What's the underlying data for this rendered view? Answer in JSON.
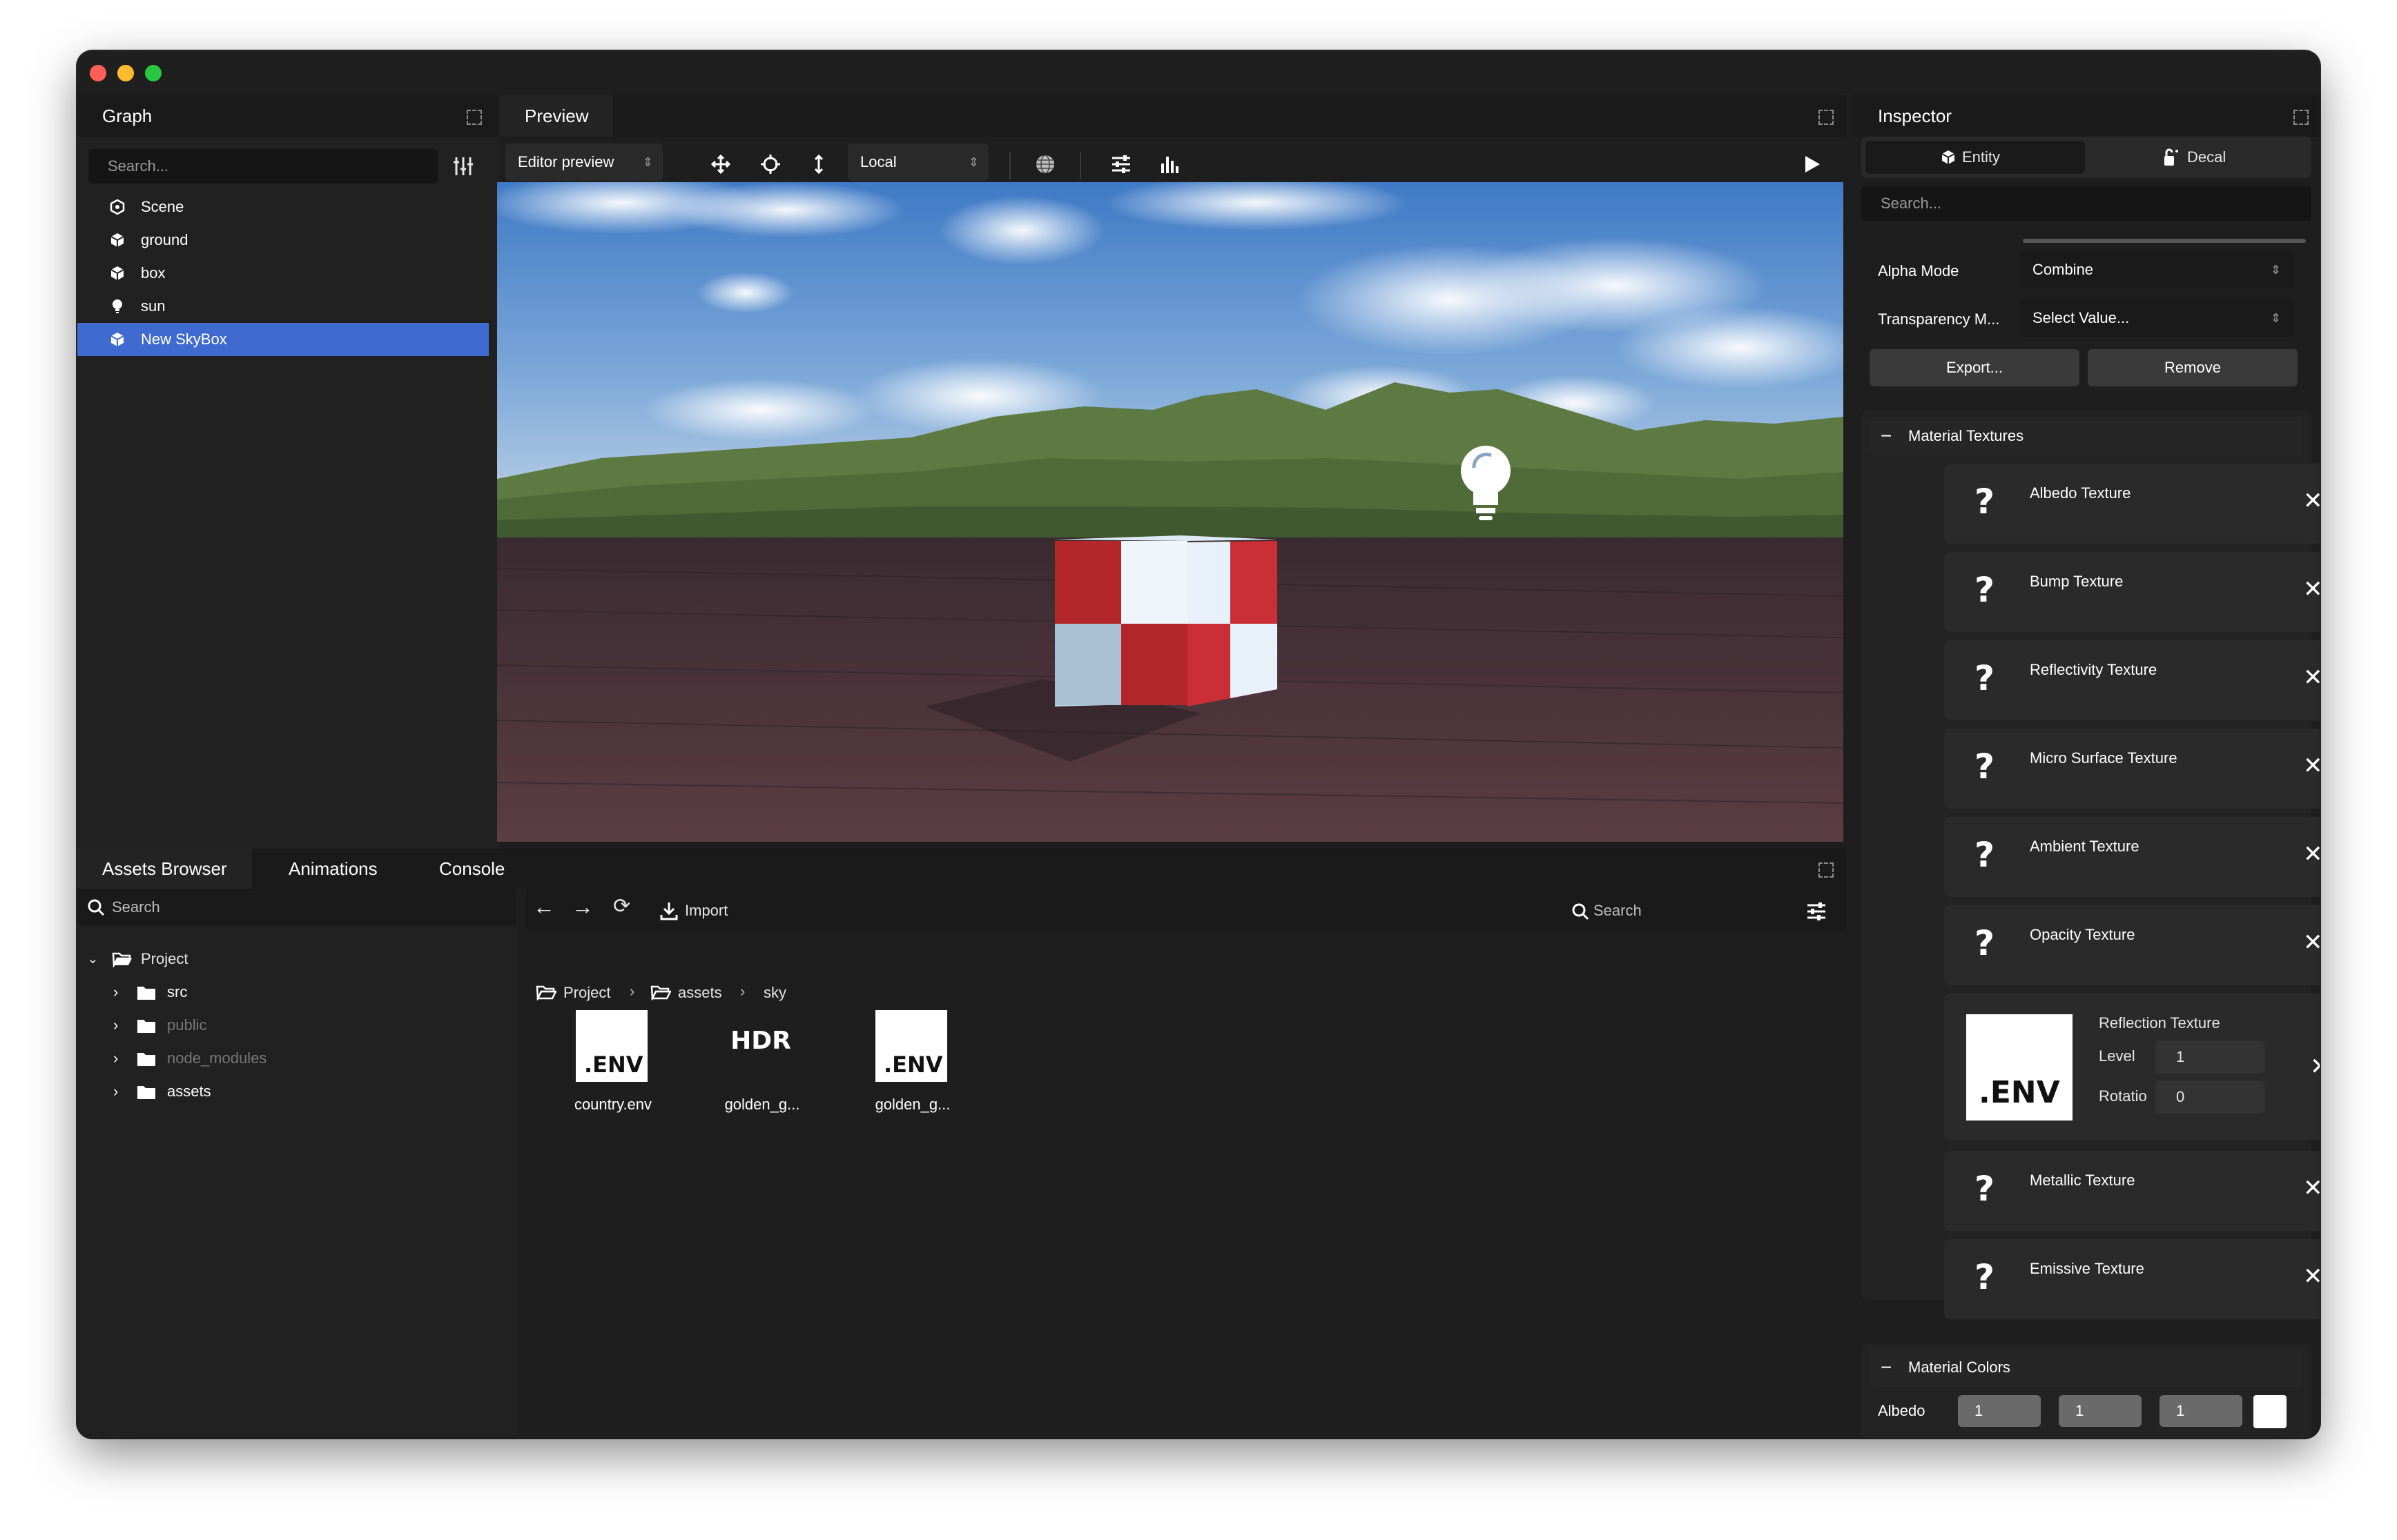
{
  "graph": {
    "tab": "Graph",
    "search_placeholder": "Search...",
    "items": [
      {
        "label": "Scene",
        "icon": "scene-icon"
      },
      {
        "label": "ground",
        "icon": "mesh-icon"
      },
      {
        "label": "box",
        "icon": "mesh-icon"
      },
      {
        "label": "sun",
        "icon": "light-bulb-icon"
      },
      {
        "label": "New SkyBox",
        "icon": "mesh-icon",
        "selected": true
      }
    ]
  },
  "preview": {
    "tab": "Preview",
    "camera_select": "Editor preview",
    "space_select": "Local",
    "tools": [
      "move-icon",
      "rotate-icon",
      "scale-icon",
      "globe-icon",
      "sliders-icon",
      "stats-icon"
    ],
    "play": "play-icon"
  },
  "inspector": {
    "tab": "Inspector",
    "modes": [
      "Entity",
      "Decal"
    ],
    "search_placeholder": "Search...",
    "alpha_mode_label": "Alpha Mode",
    "alpha_mode_value": "Combine",
    "transparency_label": "Transparency M...",
    "transparency_value": "Select Value...",
    "export_label": "Export...",
    "remove_label": "Remove",
    "material_textures_label": "Material Textures",
    "textures": [
      "Albedo Texture",
      "Bump Texture",
      "Reflectivity Texture",
      "Micro Surface Texture",
      "Ambient Texture",
      "Opacity Texture"
    ],
    "reflection": {
      "label": "Reflection Texture",
      "thumb": ".ENV",
      "level_label": "Level",
      "level_value": "1",
      "rotation_label": "Rotatio",
      "rotation_value": "0"
    },
    "textures_after": [
      "Metallic Texture",
      "Emissive Texture"
    ],
    "material_colors_label": "Material Colors",
    "albedo_label": "Albedo",
    "albedo_values": [
      "1",
      "1",
      "1"
    ],
    "albedo_swatch": "#ffffff"
  },
  "assets": {
    "tabs": [
      "Assets Browser",
      "Animations",
      "Console"
    ],
    "search_placeholder": "Search",
    "tree": {
      "root": "Project",
      "children": [
        {
          "label": "src",
          "dim": false
        },
        {
          "label": "public",
          "dim": true
        },
        {
          "label": "node_modules",
          "dim": true
        },
        {
          "label": "assets",
          "dim": false
        }
      ]
    },
    "toolbar": {
      "import_label": "Import",
      "search_placeholder": "Search"
    },
    "breadcrumb": [
      "Project",
      "assets",
      "sky"
    ],
    "files": [
      {
        "name": "country.env",
        "thumb": ".ENV",
        "kind": "env"
      },
      {
        "name": "golden_g...",
        "thumb": "HDR",
        "kind": "hdr"
      },
      {
        "name": "golden_g...",
        "thumb": ".ENV",
        "kind": "env"
      }
    ]
  },
  "colors": {
    "selection": "#3f6ad0",
    "traffic_red": "#ff5f57",
    "traffic_yellow": "#febc2e",
    "traffic_green": "#28c840"
  }
}
